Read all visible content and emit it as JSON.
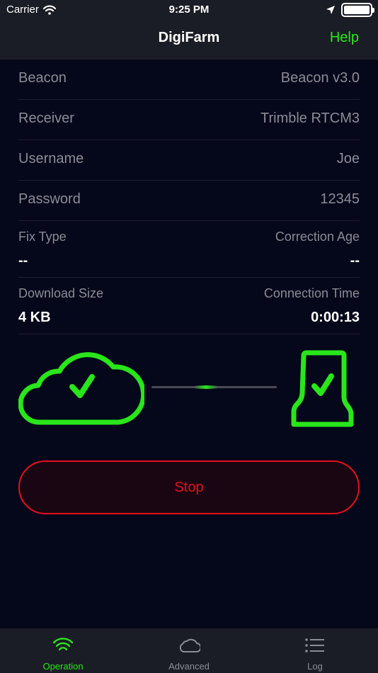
{
  "status_bar": {
    "carrier": "Carrier",
    "time": "9:25 PM"
  },
  "nav": {
    "title": "DigiFarm",
    "help_label": "Help"
  },
  "settings": [
    {
      "label": "Beacon",
      "value": "Beacon v3.0"
    },
    {
      "label": "Receiver",
      "value": "Trimble RTCM3"
    },
    {
      "label": "Username",
      "value": "Joe"
    },
    {
      "label": "Password",
      "value": "12345"
    }
  ],
  "stats": [
    {
      "left": {
        "label": "Fix Type",
        "value": "--"
      },
      "right": {
        "label": "Correction Age",
        "value": "--"
      }
    },
    {
      "left": {
        "label": "Download Size",
        "value": "4 KB"
      },
      "right": {
        "label": "Connection Time",
        "value": "0:00:13"
      }
    }
  ],
  "connection": {
    "cloud_icon": "cloud-check-icon",
    "receiver_icon": "receiver-check-icon",
    "status_color": "#29e61a"
  },
  "stop_button": {
    "label": "Stop",
    "color": "#e60f1e"
  },
  "tabs": [
    {
      "label": "Operation",
      "icon": "wifi-icon",
      "active": true
    },
    {
      "label": "Advanced",
      "icon": "cloud-icon",
      "active": false
    },
    {
      "label": "Log",
      "icon": "list-icon",
      "active": false
    }
  ],
  "colors": {
    "accent": "#29e61a",
    "danger": "#e60f1e",
    "background": "#05071a",
    "bar": "#1b1d26"
  }
}
